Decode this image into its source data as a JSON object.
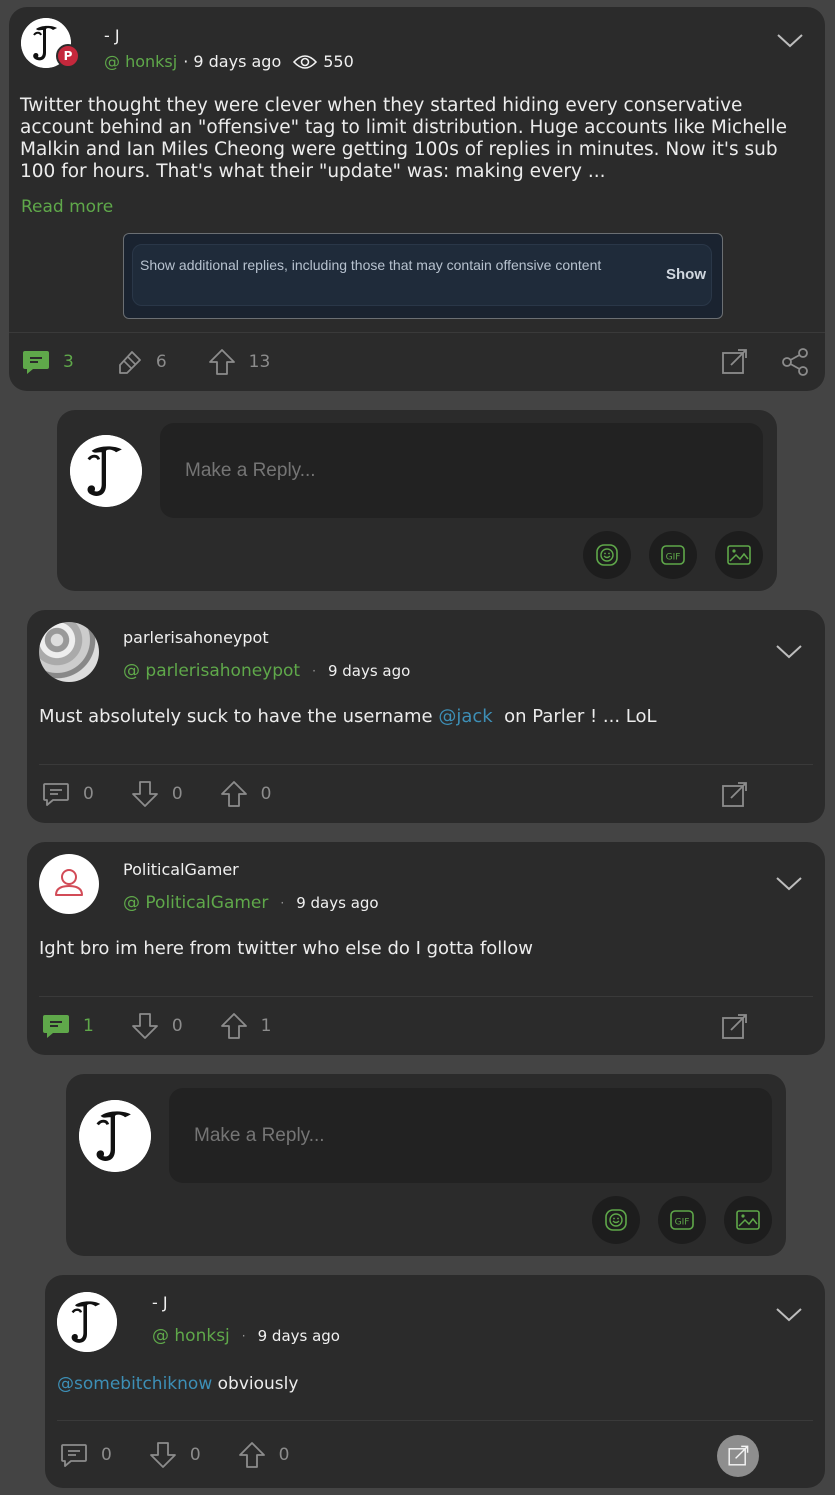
{
  "post": {
    "author_name": "- J",
    "handle": "@ honksj",
    "time": "· 9 days ago",
    "views": "550",
    "text": "Twitter thought they were clever when they started hiding every conservative account behind an \"offensive\" tag to limit distribution. Huge accounts like Michelle Malkin and Ian Miles Cheong were getting 100s of replies in minutes. Now it's sub 100 for hours. That's what their \"update\" was: making every ...",
    "read_more": "Read more",
    "notice_text": "Show additional replies, including those that may contain offensive content",
    "notice_button": "Show",
    "comments": "3",
    "echoes": "6",
    "upvotes": "13"
  },
  "reply_box_1": {
    "placeholder": "Make a Reply..."
  },
  "comments": [
    {
      "author": "parlerisahoneypot",
      "handle": "@ parlerisahoneypot",
      "dot": "·",
      "time": "9 days ago",
      "text_before": "Must absolutely suck to have the username ",
      "mention": "@jack",
      "text_after": "  on Parler ! ... LoL",
      "comments": "0",
      "downvotes": "0",
      "upvotes": "0"
    },
    {
      "author": "PoliticalGamer",
      "handle": "@ PoliticalGamer",
      "dot": "·",
      "time": "9 days ago",
      "text": "Ight bro im here from twitter who else do I gotta follow",
      "comments": "1",
      "downvotes": "0",
      "upvotes": "1"
    }
  ],
  "reply_box_2": {
    "placeholder": "Make a Reply..."
  },
  "nested_reply": {
    "author": "- J",
    "handle": "@ honksj",
    "dot": "·",
    "time": "9 days ago",
    "mention": "@somebitchiknow",
    "text": " obviously",
    "comments": "0",
    "downvotes": "0",
    "upvotes": "0"
  },
  "colors": {
    "accent_green": "#5fa84a",
    "mention_blue": "#3d8fb6",
    "card": "#2b2b2b",
    "background": "#444444"
  }
}
